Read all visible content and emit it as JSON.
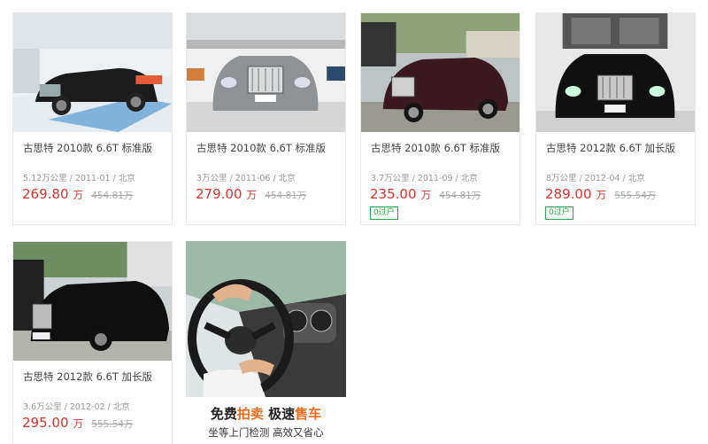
{
  "listings": [
    {
      "title": "古思特 2010款 6.6T 标准版",
      "meta": "5.12万公里 / 2011-01 / 北京",
      "price": "269.80",
      "unit": "万",
      "original_price": "454.81万",
      "badge": ""
    },
    {
      "title": "古思特 2010款 6.6T 标准版",
      "meta": "3万公里 / 2011-06 / 北京",
      "price": "279.00",
      "unit": "万",
      "original_price": "454.81万",
      "badge": ""
    },
    {
      "title": "古思特 2010款 6.6T 标准版",
      "meta": "3.7万公里 / 2011-09 / 北京",
      "price": "235.00",
      "unit": "万",
      "original_price": "454.81万",
      "badge": "0过户"
    },
    {
      "title": "古思特 2012款 6.6T 加长版",
      "meta": "8万公里 / 2012-04 / 北京",
      "price": "289.00",
      "unit": "万",
      "original_price": "555.54万",
      "badge": "0过户"
    },
    {
      "title": "古思特 2012款 6.6T 加长版",
      "meta": "3.6万公里 / 2012-02 / 北京",
      "price": "295.00",
      "unit": "万",
      "original_price": "555.54万",
      "badge": ""
    }
  ],
  "ad": {
    "line1_a": "免费",
    "line1_b": "拍卖",
    "line1_c": " 极速",
    "line1_d": "售车",
    "line2": "坐等上门检测 高效又省心"
  },
  "colors": {
    "price": "#d7322c",
    "badge": "#2aa34a",
    "ad_highlight": "#ef6a1c"
  }
}
